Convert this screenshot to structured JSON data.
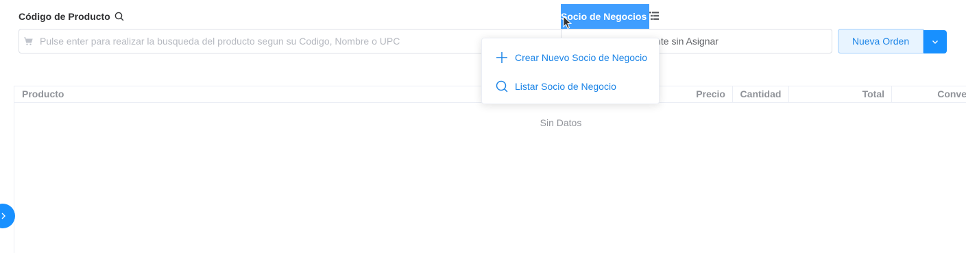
{
  "product_search": {
    "label": "Código de Producto",
    "placeholder": "Pulse enter para realizar la busqueda del producto segun su Codigo, Nombre o UPC"
  },
  "business_partner": {
    "label": "Socio de Negocios",
    "value": "Cliente sin Asignar"
  },
  "actions": {
    "new_order_label": "Nueva Orden"
  },
  "dropdown_menu": {
    "items": [
      {
        "label": "Crear Nuevo Socio de Negocio",
        "icon": "plus-icon"
      },
      {
        "label": "Listar Socio de Negocio",
        "icon": "search-icon"
      }
    ]
  },
  "table": {
    "columns": [
      "Producto",
      "Precio",
      "Cantidad",
      "Total",
      "Conve"
    ],
    "empty_text": "Sin Datos"
  },
  "colors": {
    "accent": "#1890ff",
    "link": "#1b84e7",
    "label_highlight": "#409eff"
  }
}
